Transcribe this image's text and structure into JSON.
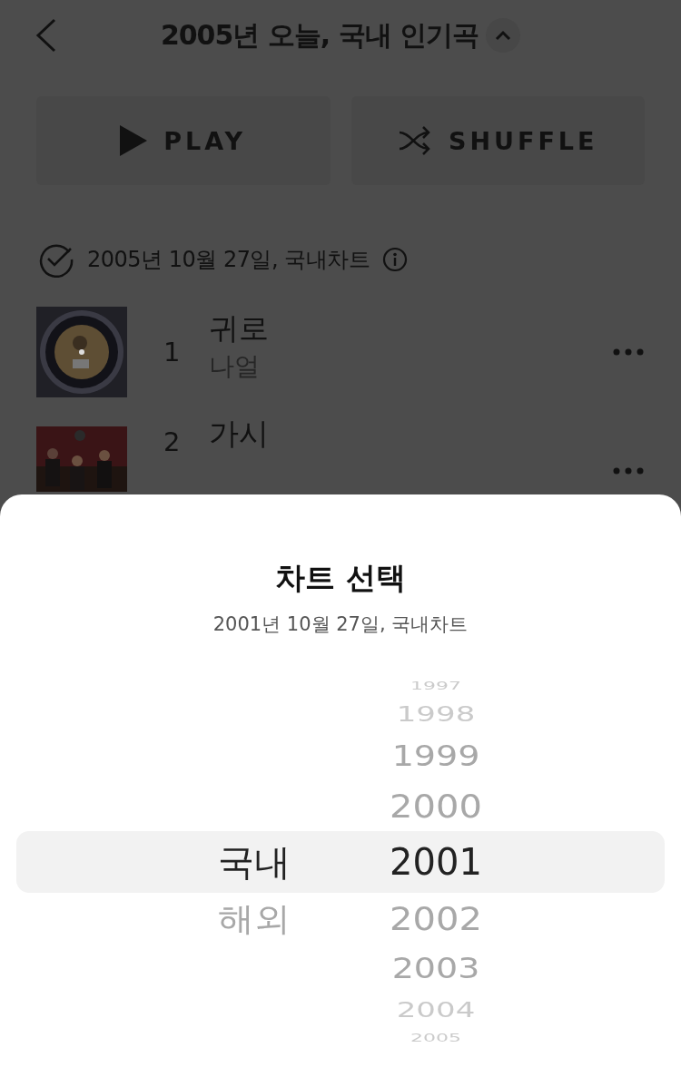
{
  "header": {
    "title": "2005년 오늘, 국내 인기곡",
    "expanded": true
  },
  "actions": [
    {
      "kind": "play",
      "label": "PLAY"
    },
    {
      "kind": "shuffle",
      "label": "SHUFFLE"
    }
  ],
  "chart_info": {
    "label": "2005년 10월 27일, 국내차트"
  },
  "tracks": [
    {
      "rank": "1",
      "title": "귀로",
      "artist": "나얼"
    },
    {
      "rank": "2",
      "title": "가시"
    }
  ],
  "sheet": {
    "title": "차트 선택",
    "subtitle": "2001년 10월 27일, 국내차트",
    "regions": [
      {
        "label": "국내",
        "selected": true
      },
      {
        "label": "해외",
        "selected": false
      }
    ],
    "years": [
      {
        "label": "1997",
        "selected": false
      },
      {
        "label": "1998",
        "selected": false
      },
      {
        "label": "1999",
        "selected": false
      },
      {
        "label": "2000",
        "selected": false
      },
      {
        "label": "2001",
        "selected": true
      },
      {
        "label": "2002",
        "selected": false
      },
      {
        "label": "2003",
        "selected": false
      },
      {
        "label": "2004",
        "selected": false
      },
      {
        "label": "2005",
        "selected": false
      }
    ]
  }
}
